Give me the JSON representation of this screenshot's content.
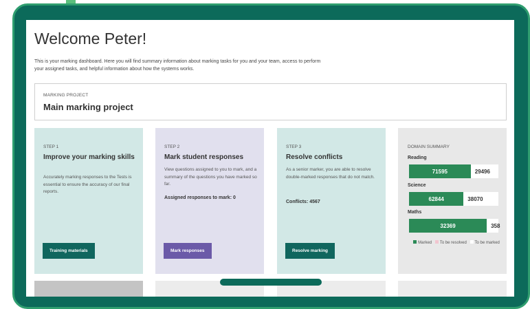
{
  "colors": {
    "device_frame": "#0c6a5a",
    "device_border": "#2f9e6f",
    "marked": "#2b8a57",
    "to_be_resolved": "#f2c6d0",
    "to_be_marked": "#ffffff",
    "teal_button": "#10665e",
    "purple_button": "#6b5aa8"
  },
  "header": {
    "welcome": "Welcome Peter!",
    "intro": "This is your marking dashboard. Here you will find summary information about marking tasks for you and your team, access to perform your assigned tasks, and helpful information about how the systems works."
  },
  "project": {
    "kicker": "MARKING PROJECT",
    "name": "Main marking project"
  },
  "cards": [
    {
      "step": "STEP 1",
      "title": "Improve your marking skills",
      "description": "Accurately marking responses to the Tests is essential to ensure the accuracy of our final reports.",
      "button": "Training materials"
    },
    {
      "step": "STEP 2",
      "title": "Mark student responses",
      "description": "View questions assigned to you to mark, and a summary of the questions you have marked so far.",
      "stat": "Assigned responses to mark: 0",
      "button": "Mark responses"
    },
    {
      "step": "STEP 3",
      "title": "Resolve conflicts",
      "description": "As a senior marker, you are able to resolve double-marked responses that do not match.",
      "stat": "Conflicts: 4567",
      "button": "Resolve marking"
    }
  ],
  "domain_summary": {
    "title": "DOMAIN SUMMARY",
    "domains": [
      {
        "name": "Reading",
        "marked": "71595",
        "to_be_marked": "29496",
        "marked_fraction": 0.69
      },
      {
        "name": "Science",
        "marked": "62844",
        "to_be_marked": "38070",
        "marked_fraction": 0.61
      },
      {
        "name": "Maths",
        "marked": "32369",
        "to_be_marked": "358",
        "marked_fraction": 0.87
      }
    ],
    "legend": {
      "marked": "Marked",
      "to_be_resolved": "To be resolved",
      "to_be_marked": "To be marked"
    }
  }
}
